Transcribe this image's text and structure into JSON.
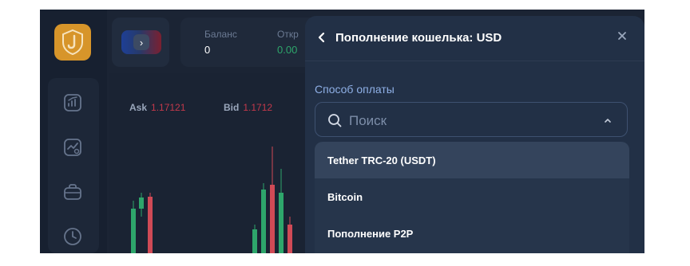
{
  "sidebar": {
    "logo_letter": "J",
    "brand_color": "#d7952a",
    "items": [
      {
        "name": "chart-icon"
      },
      {
        "name": "analytics-icon"
      },
      {
        "name": "briefcase-icon"
      },
      {
        "name": "clock-icon"
      }
    ]
  },
  "topbar": {
    "asset_arrow": "›",
    "balance_label": "Баланс",
    "balance_value": "0",
    "open_label": "Откр",
    "open_value": "0.00"
  },
  "chart_quotes": {
    "ask_label": "Ask",
    "ask_value": "1.17121",
    "bid_label": "Bid",
    "bid_value": "1.1712"
  },
  "wallet_panel": {
    "title": "Пополнение кошелька: USD",
    "payment_method_label": "Способ оплаты",
    "search_placeholder": "Поиск",
    "options": [
      {
        "label": "Tether TRC-20 (USDT)",
        "selected": true
      },
      {
        "label": "Bitcoin",
        "selected": false
      },
      {
        "label": "Пополнение P2P",
        "selected": false
      }
    ]
  },
  "colors": {
    "background": "#1b2434",
    "panel": "#223046",
    "accent": "#8fb0e6",
    "candle_up": "#2ea66b",
    "candle_down": "#d04a56"
  }
}
